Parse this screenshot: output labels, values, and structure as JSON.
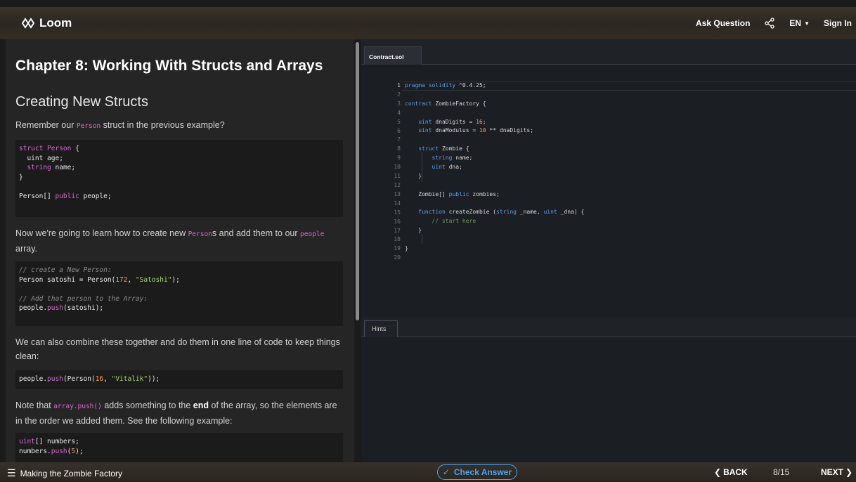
{
  "header": {
    "logo_text": "Loom",
    "ask_question": "Ask Question",
    "language": "EN",
    "sign_in": "Sign In"
  },
  "lesson": {
    "chapter_title": "Chapter 8: Working With Structs and Arrays",
    "section_title": "Creating New Structs",
    "p1_prefix": "Remember our ",
    "p1_code": "Person",
    "p1_suffix": " struct in the previous example?",
    "p2_prefix": "Now we're going to learn how to create new ",
    "p2_code1": "Person",
    "p2_mid": "s and add them to our ",
    "p2_code2": "people",
    "p2_suffix": " array.",
    "p3": "We can also combine these together and do them in one line of code to keep things clean:",
    "p4_prefix": "Note that ",
    "p4_code": "array.push()",
    "p4_mid": " adds something to the ",
    "p4_bold": "end",
    "p4_suffix": " of the array, so the elements are in the order we added them. See the following example:"
  },
  "editor": {
    "tab_label": "Contract.sol",
    "hints_label": "Hints",
    "line_numbers": [
      "1",
      "2",
      "3",
      "4",
      "5",
      "6",
      "7",
      "8",
      "9",
      "10",
      "11",
      "12",
      "13",
      "14",
      "15",
      "16",
      "17",
      "18",
      "19",
      "20"
    ]
  },
  "footer": {
    "chapter_name": "Making the Zombie Factory",
    "check_answer": "Check Answer",
    "back": "BACK",
    "page": "8/15",
    "next": "NEXT"
  },
  "colors": {
    "accent": "#4aa3f0",
    "keyword": "#d66bcf",
    "string": "#a8d46f",
    "number": "#f5a05a"
  }
}
